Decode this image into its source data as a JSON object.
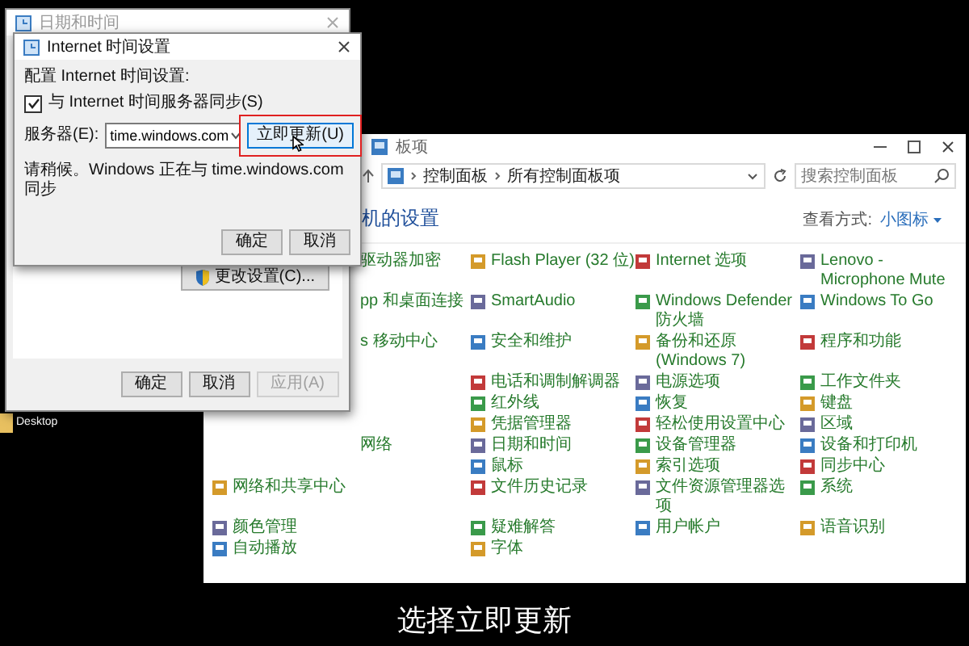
{
  "desktop": {
    "label": "Desktop"
  },
  "back_dialog": {
    "title": "日期和时间",
    "change_button": "更改设置(C)...",
    "buttons": [
      {
        "label": "确定",
        "disabled": false
      },
      {
        "label": "取消",
        "disabled": false
      },
      {
        "label": "应用(A)",
        "disabled": true
      }
    ]
  },
  "time_dialog": {
    "title": "Internet 时间设置",
    "heading": "配置 Internet 时间设置:",
    "sync": {
      "label": "与 Internet 时间服务器同步(S)",
      "checked": true
    },
    "server_label": "服务器(E):",
    "server": "time.windows.com",
    "update_button": {
      "label": "立即更新(U)",
      "highlighted": true
    },
    "status": "请稍候。Windows 正在与 time.windows.com 同步",
    "buttons": [
      "确定",
      "取消"
    ]
  },
  "control_panel": {
    "title": "板项",
    "breadcrumb": [
      "控制面板",
      "所有控制面板项"
    ],
    "search": {
      "placeholder": "搜索控制面板"
    },
    "heading": "机的设置",
    "view_label": "查看方式:",
    "view_value": "小图标",
    "rows": [
      [
        {
          "kind": "fragment",
          "label": "驱动器加密"
        },
        {
          "kind": "item",
          "label": "Flash Player (32 位)"
        },
        {
          "kind": "item",
          "label": "Internet 选项"
        },
        {
          "kind": "item",
          "label": "Lenovo - Microphone Mute"
        }
      ],
      [
        {
          "kind": "fragment",
          "label": "pp 和桌面连接"
        },
        {
          "kind": "item",
          "label": "SmartAudio"
        },
        {
          "kind": "item",
          "label": "Windows Defender 防火墙"
        },
        {
          "kind": "item",
          "label": "Windows To Go"
        }
      ],
      [
        {
          "kind": "fragment",
          "label": "s 移动中心"
        },
        {
          "kind": "item",
          "label": "安全和维护"
        },
        {
          "kind": "item",
          "label": "备份和还原(Windows 7)"
        },
        {
          "kind": "item",
          "label": "程序和功能"
        }
      ],
      [
        {
          "kind": "covered"
        },
        {
          "kind": "item",
          "label": "电话和调制解调器"
        },
        {
          "kind": "item",
          "label": "电源选项"
        },
        {
          "kind": "item",
          "label": "工作文件夹"
        }
      ],
      [
        {
          "kind": "covered"
        },
        {
          "kind": "item",
          "label": "红外线"
        },
        {
          "kind": "item",
          "label": "恢复"
        },
        {
          "kind": "item",
          "label": "键盘"
        }
      ],
      [
        {
          "kind": "covered"
        },
        {
          "kind": "item",
          "label": "凭据管理器"
        },
        {
          "kind": "item",
          "label": "轻松使用设置中心"
        },
        {
          "kind": "item",
          "label": "区域"
        }
      ],
      [
        {
          "kind": "fragment",
          "label": "网络"
        },
        {
          "kind": "item",
          "label": "日期和时间"
        },
        {
          "kind": "item",
          "label": "设备管理器"
        },
        {
          "kind": "item",
          "label": "设备和打印机"
        }
      ],
      [
        {
          "kind": "covered"
        },
        {
          "kind": "item",
          "label": "鼠标"
        },
        {
          "kind": "item",
          "label": "索引选项"
        },
        {
          "kind": "item",
          "label": "同步中心"
        }
      ],
      [
        {
          "kind": "item",
          "label": "网络和共享中心"
        },
        {
          "kind": "item",
          "label": "文件历史记录"
        },
        {
          "kind": "item",
          "label": "文件资源管理器选项"
        },
        {
          "kind": "item",
          "label": "系统"
        }
      ],
      [
        {
          "kind": "item",
          "label": "颜色管理"
        },
        {
          "kind": "item",
          "label": "疑难解答"
        },
        {
          "kind": "item",
          "label": "用户帐户"
        },
        {
          "kind": "item",
          "label": "语音识别"
        }
      ],
      [
        {
          "kind": "item",
          "label": "自动播放"
        },
        {
          "kind": "item",
          "label": "字体"
        }
      ]
    ]
  },
  "caption": "选择立即更新"
}
